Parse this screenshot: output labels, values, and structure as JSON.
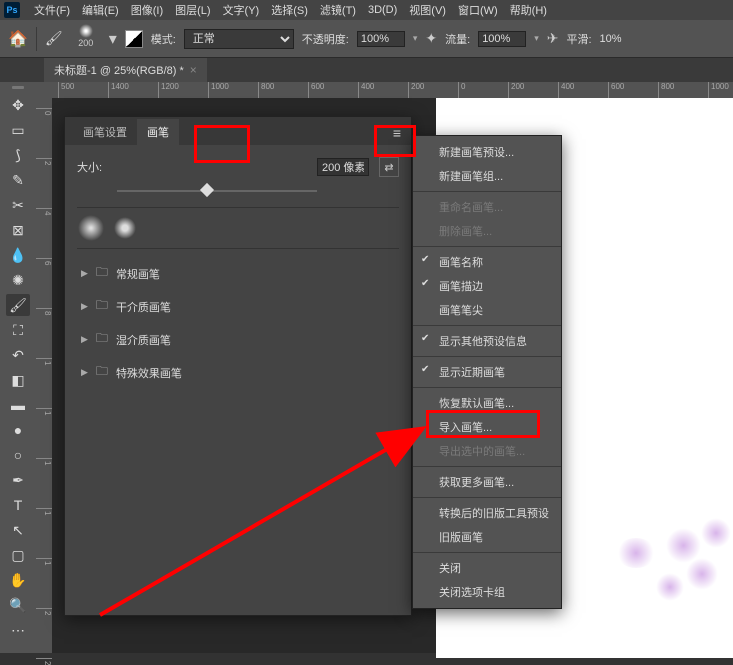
{
  "menubar": {
    "logo": "Ps",
    "items": [
      "文件(F)",
      "编辑(E)",
      "图像(I)",
      "图层(L)",
      "文字(Y)",
      "选择(S)",
      "滤镜(T)",
      "3D(D)",
      "视图(V)",
      "窗口(W)",
      "帮助(H)"
    ]
  },
  "toolbar": {
    "brush_size": "200",
    "mode_label": "模式:",
    "mode_value": "正常",
    "opacity_label": "不透明度:",
    "opacity_value": "100%",
    "flow_label": "流量:",
    "flow_value": "100%",
    "smoothing_label": "平滑:",
    "smoothing_value": "10%"
  },
  "doc_tab": {
    "title": "未标题-1 @ 25%(RGB/8) *"
  },
  "ruler_h": [
    "500",
    "1400",
    "1200",
    "1000",
    "800",
    "600",
    "400",
    "200",
    "0",
    "200",
    "400",
    "600",
    "800",
    "1000"
  ],
  "ruler_v": [
    "0",
    "2",
    "4",
    "6",
    "8",
    "1",
    "1",
    "1",
    "1",
    "1",
    "2",
    "2"
  ],
  "panel": {
    "tabs": {
      "settings": "画笔设置",
      "brush": "画笔"
    },
    "size_label": "大小:",
    "size_value": "200 像素",
    "folders": [
      "常规画笔",
      "干介质画笔",
      "湿介质画笔",
      "特殊效果画笔"
    ]
  },
  "context_menu": {
    "new_preset": "新建画笔预设...",
    "new_group": "新建画笔组...",
    "rename": "重命名画笔...",
    "delete": "删除画笔...",
    "brush_name": "画笔名称",
    "brush_stroke": "画笔描边",
    "brush_tip": "画笔笔尖",
    "show_other": "显示其他预设信息",
    "show_recent": "显示近期画笔",
    "restore_default": "恢复默认画笔...",
    "import": "导入画笔...",
    "export_selected": "导出选中的画笔...",
    "get_more": "获取更多画笔...",
    "convert_legacy": "转换后的旧版工具预设",
    "legacy": "旧版画笔",
    "close": "关闭",
    "close_group": "关闭选项卡组"
  }
}
